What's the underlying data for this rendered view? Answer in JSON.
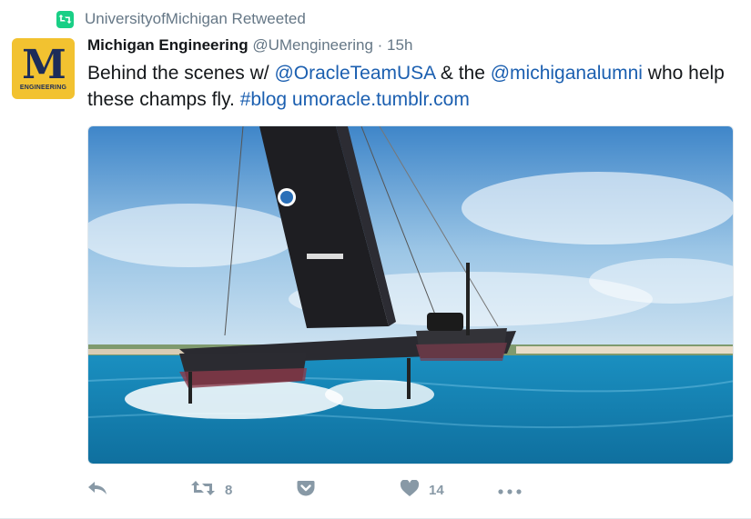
{
  "retweet_context": {
    "text": "UniversityofMichigan Retweeted",
    "icon": "retweet-icon",
    "color": "#19cf86"
  },
  "author": {
    "display_name": "Michigan Engineering",
    "handle": "@UMengineering",
    "separator": "·",
    "time": "15h",
    "avatar": {
      "letter": "M",
      "subtitle": "ENGINEERING",
      "background": "#f2c230",
      "foreground": "#1c2c59"
    }
  },
  "tweet": {
    "text_1": "Behind the scenes w/ ",
    "mention_1": "@OracleTeamUSA",
    "text_2": " & the ",
    "mention_2": "@michiganalumni",
    "text_3": "   who help these champs fly. ",
    "hashtag": "#blog",
    "text_4": " ",
    "url": "umoracle.tumblr.com",
    "link_color": "#1b5fb0"
  },
  "media": {
    "description_icon": "photo-sailboat"
  },
  "actions": {
    "reply_icon": "reply-icon",
    "retweet_icon": "retweet-icon",
    "retweet_count": "8",
    "pocket_icon": "pocket-icon",
    "like_icon": "heart-icon",
    "like_count": "14",
    "more_icon": "more-icon",
    "color": "#8899a6"
  }
}
